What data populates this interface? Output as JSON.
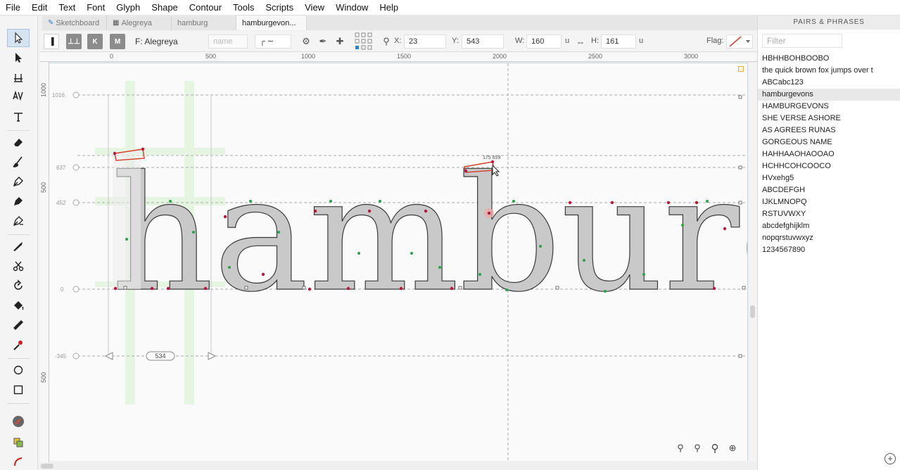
{
  "menu": [
    "File",
    "Edit",
    "Text",
    "Font",
    "Glyph",
    "Shape",
    "Contour",
    "Tools",
    "Scripts",
    "View",
    "Window",
    "Help"
  ],
  "tabs": [
    {
      "label": "Sketchboard",
      "icon": "pencil-icon",
      "active": false
    },
    {
      "label": "Alegreya",
      "icon": "grid-icon",
      "active": false
    },
    {
      "label": "hamburg",
      "active": false
    },
    {
      "label": "hamburgevon...",
      "active": true
    }
  ],
  "options": {
    "font_label": "F: Alegreya",
    "name_placeholder": "name",
    "x_label": "X:",
    "x_value": "23",
    "y_label": "Y:",
    "y_value": "543",
    "w_label": "W:",
    "w_value": "160",
    "w_unit": "u",
    "h_label": "H:",
    "h_value": "161",
    "h_unit": "u",
    "flag_label": "Flag:",
    "view_mode_labels": [
      "K",
      "M"
    ]
  },
  "ruler": {
    "top": [
      "0",
      "500",
      "1000",
      "1500",
      "2000",
      "2500",
      "3000"
    ],
    "left": [
      "1000",
      "500",
      "500"
    ]
  },
  "metrics": {
    "ascender": "1016",
    "xheight_high": "637",
    "xheight": "452",
    "baseline": "0",
    "descender": "-345",
    "advance_width": "534",
    "selection_readout": "175   659"
  },
  "canvas_text": "hamburgevons",
  "right_panel": {
    "title": "PAIRS & PHRASES",
    "filter_placeholder": "Filter",
    "phrases": [
      "HBHHBOHBOOBO",
      "the quick brown fox jumps over t",
      "ABCabc123",
      "hamburgevons",
      "HAMBURGEVONS",
      "SHE VERSE ASHORE",
      "AS AGREES RUNAS",
      "GORGEOUS NAME",
      "HAHHAAOHAOOAO",
      "HCHHCOHCOOCO",
      "HVxehg5",
      "ABCDEFGH",
      "IJKLMNOPQ",
      "RSTUVWXY",
      "abcdefghijklm",
      "nopqrstuvwxyz",
      "1234567890"
    ],
    "selected_index": 3,
    "add_label": "+"
  },
  "colors": {
    "glyph_fill": "#c9c9c9",
    "glyph_fill_selected": "#e9e9e9",
    "node_corner": "#b8163a",
    "node_smooth": "#2aa14a",
    "selection": "#d84032",
    "tool_active": "#d6e4f2"
  },
  "icons": {
    "tools": [
      "select-arrow-icon",
      "direct-select-icon",
      "metrics-icon",
      "kerning-icon",
      "text-tool-icon",
      "eraser-icon",
      "brush-icon",
      "pen-nib-icon",
      "pen-tool-icon",
      "pen-alt-icon",
      "knife-icon",
      "scissors-icon",
      "rotate-icon",
      "fill-bucket-icon",
      "ruler-icon",
      "eyedropper-icon",
      "ellipse-icon",
      "rectangle-icon",
      "color-picker-icon",
      "layers-icon",
      "ink-icon"
    ],
    "zoom": [
      "zoom-out-icon",
      "zoom-icon",
      "zoom-in-icon",
      "zoom-fit-icon"
    ]
  }
}
